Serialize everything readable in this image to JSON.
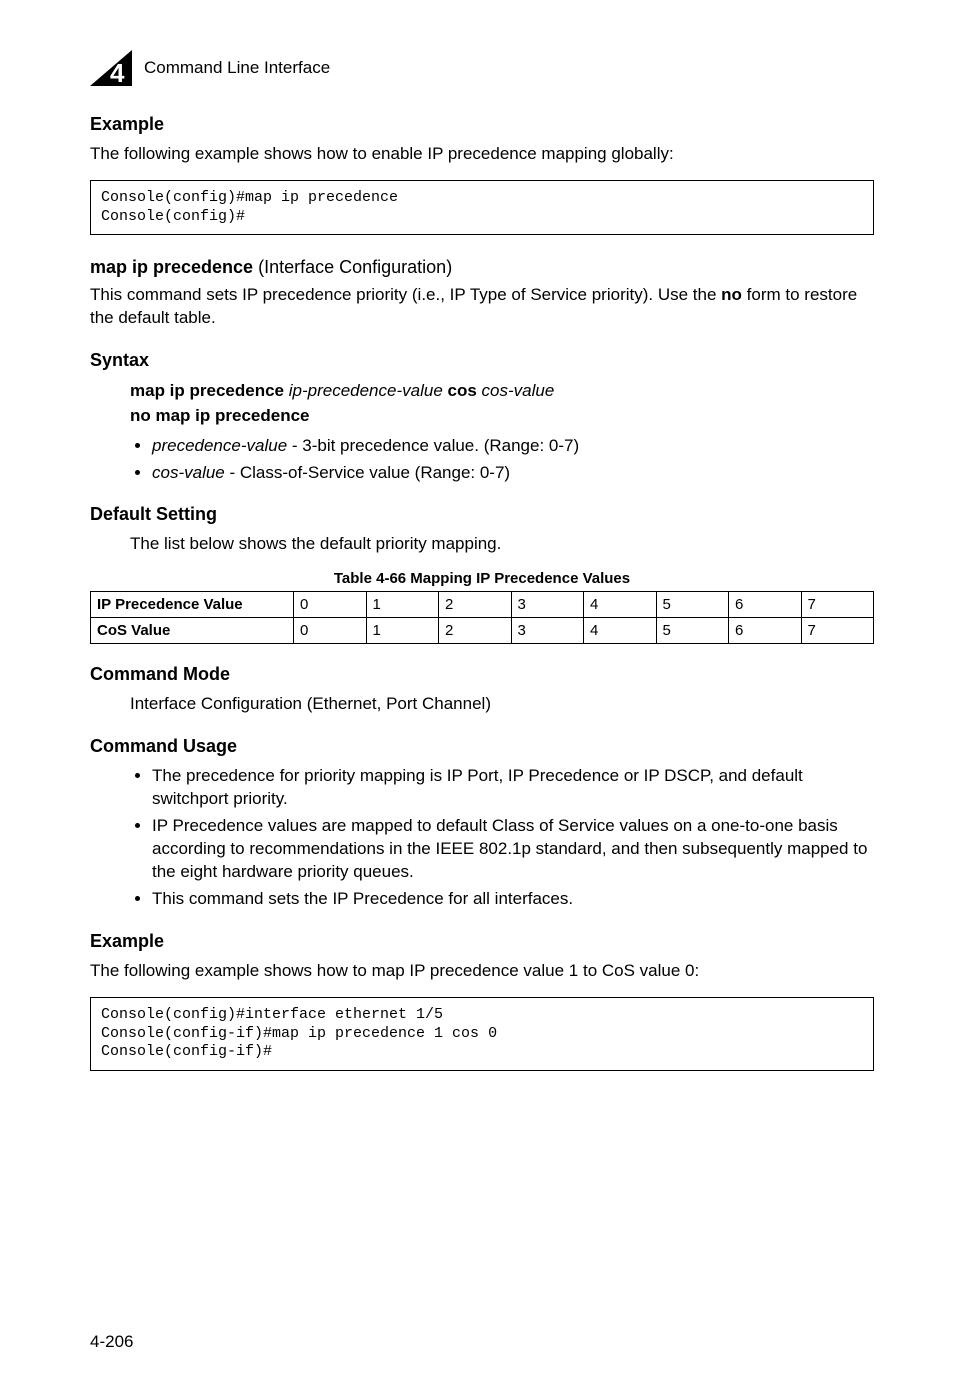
{
  "header": {
    "chapter_number": "4",
    "section_label": "Command Line Interface"
  },
  "example1": {
    "heading": "Example",
    "para": "The following example shows how to enable IP precedence mapping globally:",
    "code": "Console(config)#map ip precedence\nConsole(config)#"
  },
  "cmd": {
    "name": "map ip precedence",
    "context": "(Interface Configuration)",
    "desc_pre": "This command sets IP precedence priority (i.e., IP Type of Service priority). Use the ",
    "desc_bold": "no",
    "desc_post": " form to restore the default table."
  },
  "syntax": {
    "heading": "Syntax",
    "line1_b1": "map ip precedence ",
    "line1_i1": "ip-precedence-value",
    "line1_b2": " cos ",
    "line1_i2": "cos-value",
    "line2": "no map ip precedence",
    "bullet1_i": "precedence-value",
    "bullet1_t": " - 3-bit precedence value. (Range: 0-7)",
    "bullet2_i": "cos-value",
    "bullet2_t": " - Class-of-Service value (Range: 0-7)"
  },
  "defaults": {
    "heading": "Default Setting",
    "para": "The list below shows the default priority mapping."
  },
  "chart_data": {
    "type": "table",
    "title": "Table 4-66  Mapping IP Precedence Values",
    "columns": [
      "",
      "0",
      "1",
      "2",
      "3",
      "4",
      "5",
      "6",
      "7"
    ],
    "rows": [
      {
        "label": "IP Precedence Value",
        "values": [
          "0",
          "1",
          "2",
          "3",
          "4",
          "5",
          "6",
          "7"
        ]
      },
      {
        "label": "CoS Value",
        "values": [
          "0",
          "1",
          "2",
          "3",
          "4",
          "5",
          "6",
          "7"
        ]
      }
    ]
  },
  "cmd_mode": {
    "heading": "Command Mode",
    "para": "Interface Configuration (Ethernet, Port Channel)"
  },
  "cmd_usage": {
    "heading": "Command Usage",
    "b1": "The precedence for priority mapping is IP Port, IP Precedence or IP DSCP, and default switchport priority.",
    "b2": "IP Precedence values are mapped to default Class of Service values on a one-to-one basis according to recommendations in the IEEE 802.1p standard, and then subsequently mapped to the eight hardware priority queues.",
    "b3": "This command sets the IP Precedence for all interfaces."
  },
  "example2": {
    "heading": "Example",
    "para": "The following example shows how to map IP precedence value 1 to CoS value 0:",
    "code": "Console(config)#interface ethernet 1/5\nConsole(config-if)#map ip precedence 1 cos 0\nConsole(config-if)#"
  },
  "footer": {
    "page": "4-206"
  }
}
